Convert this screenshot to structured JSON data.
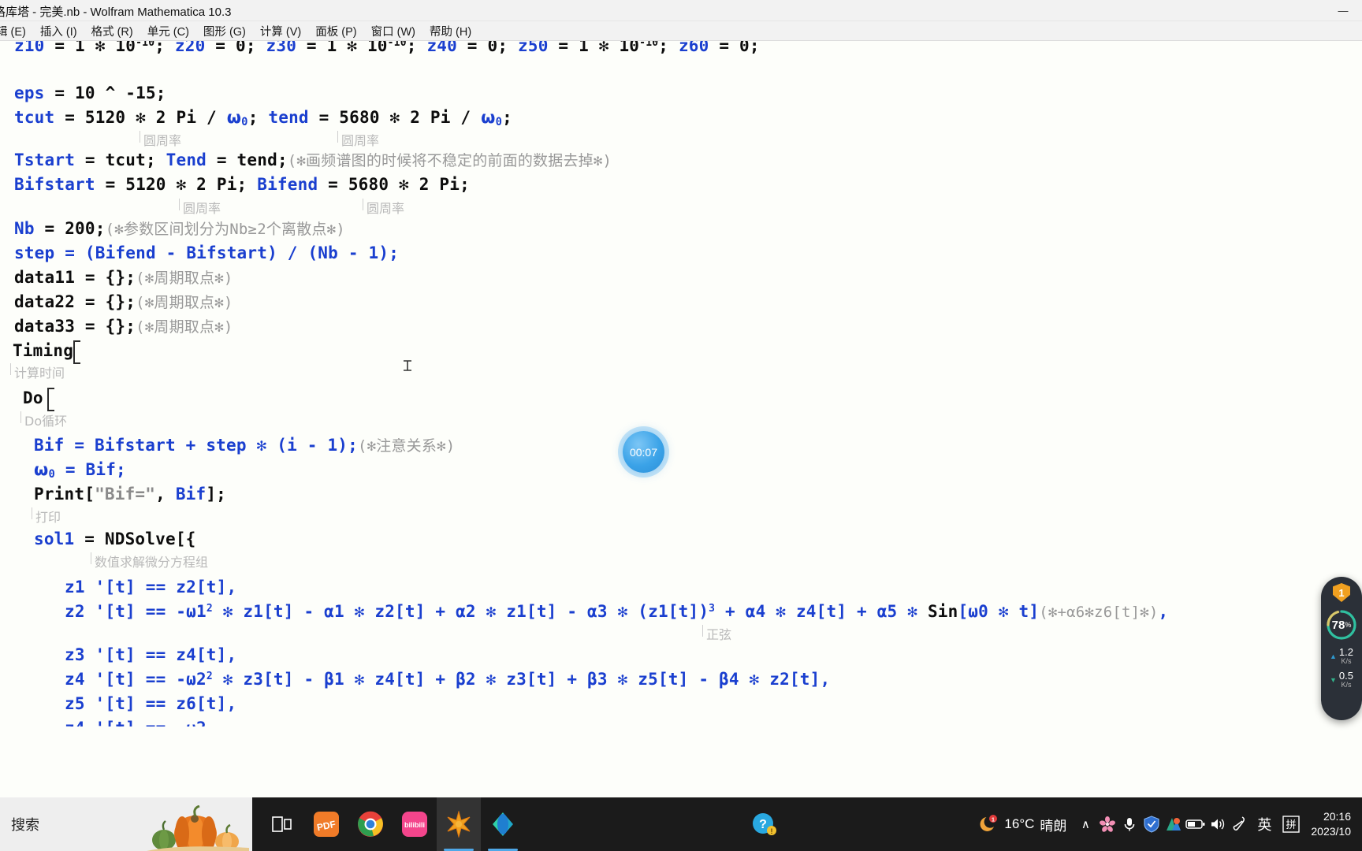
{
  "window": {
    "title": "格库塔 - 完美.nb - Wolfram Mathematica 10.3",
    "minimize_label": "—",
    "maximize_label": "▢",
    "close_label": "✕"
  },
  "menu": {
    "items": [
      {
        "label": "辑 (E)",
        "name": "menu-edit"
      },
      {
        "label": "插入 (I)",
        "name": "menu-insert"
      },
      {
        "label": "格式 (R)",
        "name": "menu-format"
      },
      {
        "label": "单元 (C)",
        "name": "menu-cell"
      },
      {
        "label": "图形 (G)",
        "name": "menu-graphics"
      },
      {
        "label": "计算 (V)",
        "name": "menu-evaluation"
      },
      {
        "label": "面板 (P)",
        "name": "menu-palettes"
      },
      {
        "label": "窗口 (W)",
        "name": "menu-window"
      },
      {
        "label": "帮助 (H)",
        "name": "menu-help"
      }
    ]
  },
  "notebook": {
    "line_z_inits": "z10 = 1 * 10",
    "code": {
      "l1_a": "z10",
      "l1_b": " = 1 ✻ 10",
      "l1_sup": "-10",
      "l1_c": "; ",
      "l1_d": "z20",
      "l1_e": " = 0; ",
      "l1_f": "z30",
      "l1_g": " = 1 ✻ 10",
      "l1_h": "; ",
      "l1_i": "z40",
      "l1_j": " = 0; ",
      "l1_k": "z50",
      "l1_l": " = 1 ✻ 10",
      "l1_m": "; ",
      "l1_n": "z60",
      "l1_o": " = 0;",
      "eps_var": "eps",
      "eps_rest": " = 10 ^ -15;",
      "tcut_v1": "tcut",
      "tcut_eq": " = 5120 ✻ 2 Pi / ",
      "tcut_w": "ω",
      "tcut_wsub": "0",
      "tcut_semi": "; ",
      "tend_v": "tend",
      "tend_eq": " = 5680 ✻ 2 Pi / ",
      "tstart_v": "Tstart",
      "tstart_eq": " = tcut",
      "tstart_semi": "; ",
      "tend2_v": "Tend",
      "tend2_eq": " = tend",
      "tend2_semi": ";",
      "tstart_cmt": "(✻画频谱图的时候将不稳定的前面的数据去掉✻)",
      "bifstart_v": "Bifstart",
      "bifstart_eq": " = 5120 ✻ 2 Pi; ",
      "bifend_v": "Bifend",
      "bifend_eq": " = 5680 ✻ 2 Pi;",
      "nb_v": "Nb",
      "nb_eq": " = 200;",
      "nb_cmt": "(✻参数区间划分为Nb≥2个离散点✻)",
      "step_line": "step = (Bifend - Bifstart) / (Nb - 1);",
      "data11": "data11 = {};",
      "data11_cmt": "(✻周期取点✻)",
      "data22": "data22 = {};",
      "data22_cmt": "(✻周期取点✻)",
      "data33": "data33 = {};",
      "data33_cmt": "(✻周期取点✻)",
      "timing": "Timing",
      "timing_hint": "计算时间",
      "do": "Do",
      "do_hint": "Do循环",
      "bif_line": "Bif = Bifstart + step ✻ (i - 1);",
      "bif_cmt": "(✻注意关系✻)",
      "omega_assign_w": "ω",
      "omega_assign_sub": "0",
      "omega_assign_rest": " = Bif;",
      "print_fn": "Print",
      "print_args_open": "[",
      "print_str": "\"Bif=\"",
      "print_args_mid": ", ",
      "print_var": "Bif",
      "print_close": "];",
      "print_hint": "打印",
      "sol1_v": "sol1",
      "sol1_eq": " = ",
      "ndsolve": "NDSolve",
      "ndsolve_open": "[{",
      "ndsolve_hint": "数值求解微分方程组",
      "eq1": "z1 '[t] == z2[t],",
      "eq2_part1": "z2 '[t] == -ω1",
      "eq2_sup": "2",
      "eq2_part2": " ✻ z1[t] - α1 ✻ z2[t] + α2 ✻ z1[t] - α3 ✻ (z1[t])",
      "eq2_sup2": "3",
      "eq2_part3": " + α4 ✻ z4[t] + α5 ✻ ",
      "eq2_sin": "Sin",
      "eq2_part4": "[ω0 ✻ t]",
      "eq2_cmt": "(✻+α6✻z6[t]✻)",
      "eq2_tail": ",",
      "eq2_sin_hint": "正弦",
      "eq3": "z3 '[t] == z4[t],",
      "eq4_part1": "z4 '[t] == -ω2",
      "eq4_sup": "2",
      "eq4_part2": " ✻ z3[t] - β1 ✻ z4[t] + β2 ✻ z3[t] + β3 ✻ z5[t] - β4 ✻ z2[t],",
      "eq5": "z5 '[t] == z6[t],"
    }
  },
  "timer": {
    "elapsed": "00:07"
  },
  "monitor": {
    "shield_badge": "1",
    "cpu_percent": "78",
    "percent_symbol": "%",
    "upload_value": "1.2",
    "upload_unit": "K/s",
    "download_value": "0.5",
    "download_unit": "K/s",
    "ring_color": "#2fc0a0",
    "ring_color_2": "#d8c86a"
  },
  "taskbar": {
    "search_placeholder": "搜索",
    "buttons": [
      {
        "name": "taskview-button",
        "label": "task-view-icon"
      },
      {
        "name": "pdf-app-button",
        "label": "PDF"
      },
      {
        "name": "chrome-button",
        "label": "chrome-icon"
      },
      {
        "name": "bilibili-button",
        "label": "bilibili"
      },
      {
        "name": "mathematica-button",
        "label": "mathematica-icon"
      },
      {
        "name": "app-teal-button",
        "label": "teal-app-icon"
      }
    ],
    "tray": {
      "weather_temp": "16°C",
      "weather_desc": "晴朗",
      "notification_badge": "1",
      "chevron": "∧",
      "ime_lang": "英",
      "ime_mode": "拼",
      "clock_time": "20:16",
      "clock_date": "2023/10"
    }
  }
}
